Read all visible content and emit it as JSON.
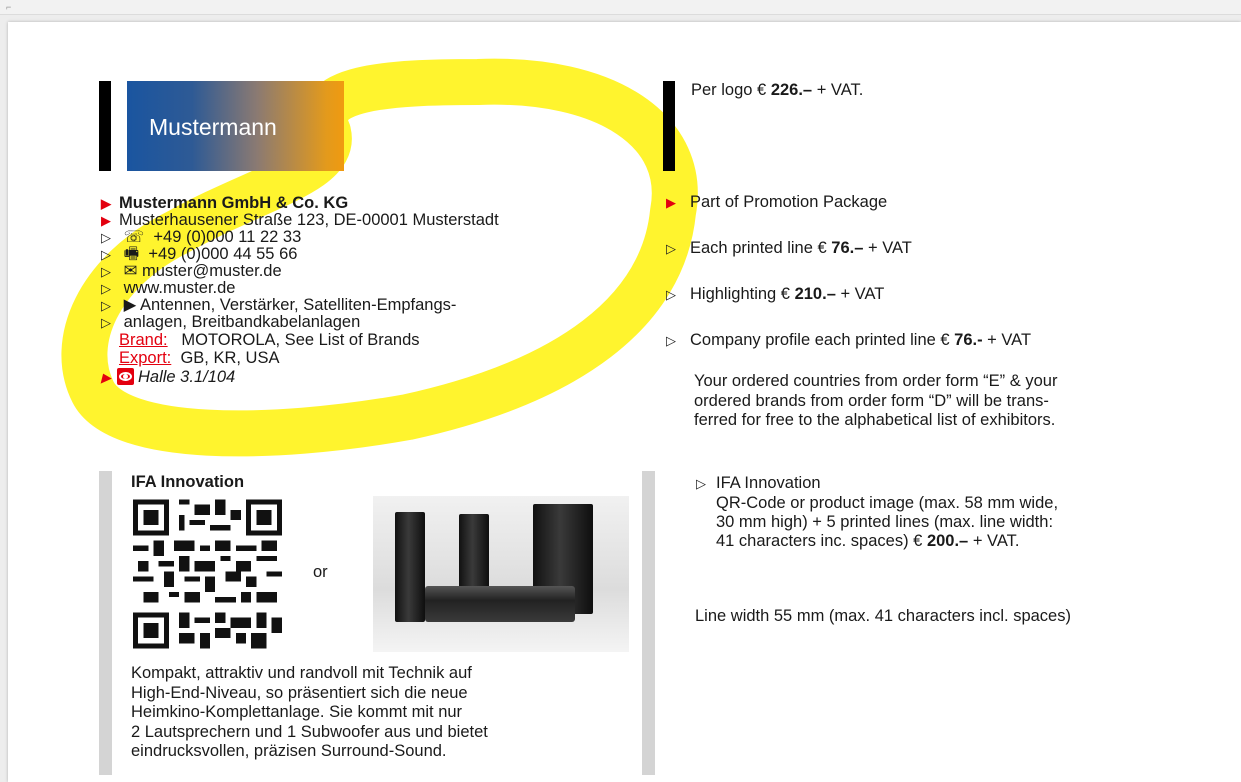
{
  "logo": {
    "text": "Mustermann"
  },
  "listing": {
    "company": "Mustermann GmbH & Co. KG",
    "address": "Musterhausener Straße 123, DE-00001 Musterstadt",
    "phone_icon": "☏",
    "phone": "+49 (0)000 11 22 33",
    "fax_icon": "🖷",
    "fax": "+49 (0)000 44 55 66",
    "email_icon": "✉",
    "email": "muster@muster.de",
    "web": "www.muster.de",
    "products_line1": "▶ Antennen, Verstärker, Satelliten-Empfangs-",
    "products_line2": "anlagen, Breitbandkabelanlagen",
    "brand_label": "Brand:",
    "brand_value": "MOTOROLA, See List of Brands",
    "export_label": "Export:",
    "export_value": "GB, KR, USA",
    "hall": "Halle 3.1/104"
  },
  "right": {
    "logo_price_pre": "Per logo € ",
    "logo_price": "226.–",
    "logo_price_post": " + VAT.",
    "promo": "Part of Promotion Package",
    "line_price_pre": "Each printed line € ",
    "line_price": "76.–",
    "line_price_post": " + VAT",
    "highlight_pre": "Highlighting € ",
    "highlight_price": "210.–",
    "highlight_post": " + VAT",
    "profile_pre": "Company profile each printed line € ",
    "profile_price": "76.-",
    "profile_post": " + VAT",
    "note_line1": "Your ordered countries from order form “E” & your",
    "note_line2": "ordered brands from order form “D” will be trans-",
    "note_line3": "ferred for free to the alphabetical list of exhibitors.",
    "innovation_title": "IFA Innovation",
    "innovation_line1": "QR-Code or product image (max. 58 mm wide,",
    "innovation_line2": "30 mm high) + 5 printed lines (max. line width:",
    "innovation_line3_pre": "41 characters inc. spaces) € ",
    "innovation_price": "200.–",
    "innovation_line3_post": " + VAT.",
    "line_width": "Line width 55 mm (max. 41 characters incl. spaces)"
  },
  "innovation": {
    "title": "IFA Innovation",
    "or": "or",
    "text_lines": [
      "Kompakt, attraktiv und randvoll mit Technik auf",
      "High-End-Niveau, so präsentiert sich die neue",
      "Heimkino-Komplettanlage. Sie kommt mit nur",
      "2 Lautsprechern und 1 Subwoofer aus und bietet",
      "eindrucksvollen, präzisen Surround-Sound."
    ]
  },
  "colors": {
    "accent_red": "#e3000f",
    "highlight_yellow": "#fff200",
    "logo_blue": "#1a55a0",
    "logo_orange": "#f09a10"
  }
}
